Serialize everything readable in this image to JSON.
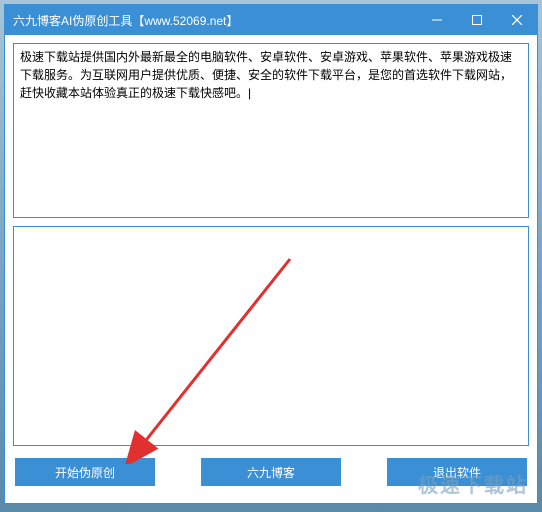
{
  "window": {
    "title": "六九博客AI伪原创工具【www.52069.net】"
  },
  "input": {
    "text": "极速下载站提供国内外最新最全的电脑软件、安卓软件、安卓游戏、苹果软件、苹果游戏极速下载服务。为互联网用户提供优质、便捷、安全的软件下载平台，是您的首选软件下载网站，赶快收藏本站体验真正的极速下载快感吧。|"
  },
  "output": {
    "text": ""
  },
  "buttons": {
    "start": "开始伪原创",
    "blog": "六九博客",
    "exit": "退出软件"
  },
  "watermark": "极速下载站"
}
